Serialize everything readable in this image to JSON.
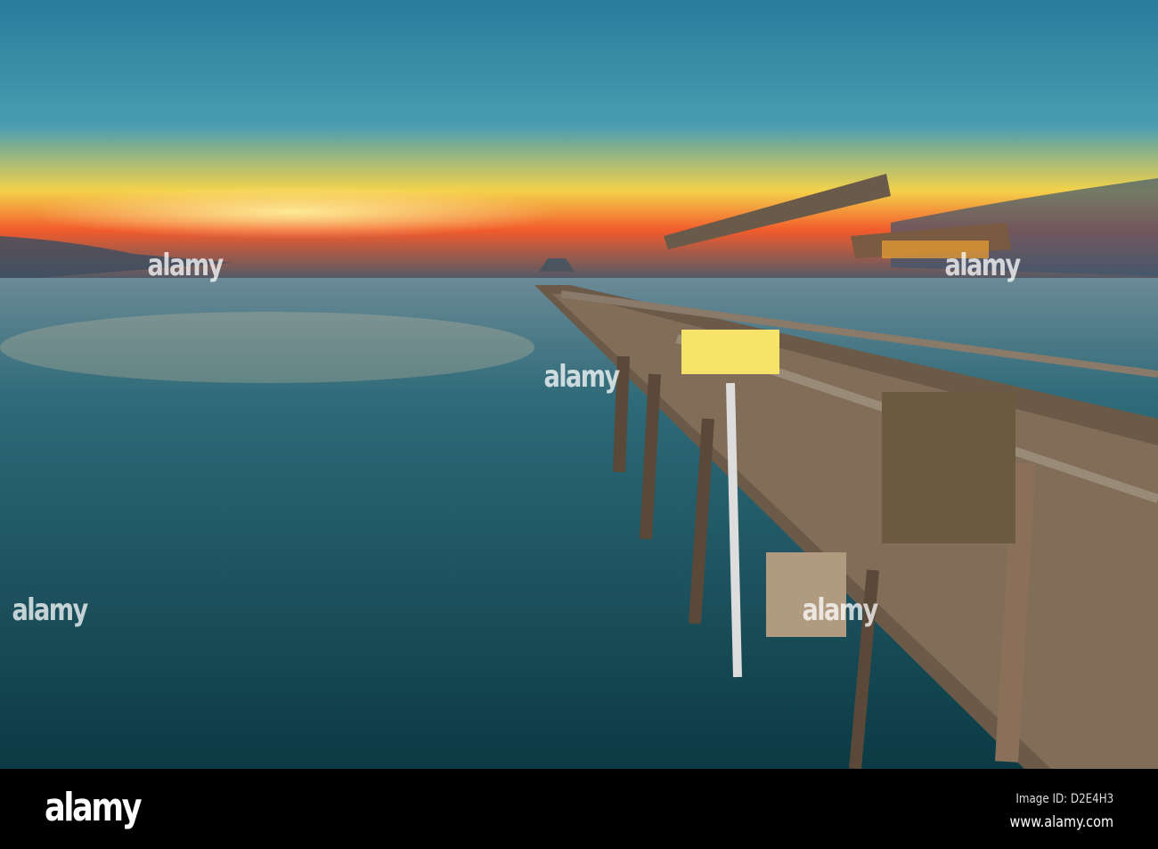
{
  "watermark": {
    "text": "alamy"
  },
  "footer": {
    "logo": "alamy",
    "image_id": "Image ID: D2E4H3",
    "url": "www.alamy.com"
  },
  "colors": {
    "sky_top": "#2d7fa0",
    "sunset": "#f7b52a",
    "water": "#0e4550"
  }
}
